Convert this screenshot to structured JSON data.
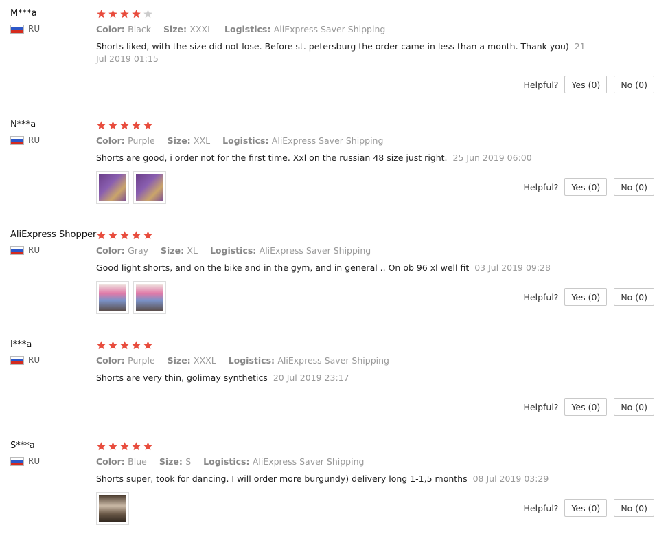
{
  "colors": {
    "star_on": "#e84c3d",
    "star_off": "#cccccc",
    "muted": "#999999"
  },
  "labels": {
    "color": "Color:",
    "size": "Size:",
    "logistics": "Logistics:",
    "helpful": "Helpful?"
  },
  "reviews": [
    {
      "user": "M***a",
      "country": "RU",
      "rating": 4,
      "color": "Black",
      "size": "XXXL",
      "logistics": "AliExpress Saver Shipping",
      "text": "Shorts liked, with the size did not lose. Before st. petersburg the order came in less than a month. Thank you)",
      "date": "21 Jul 2019 01:15",
      "photos": [],
      "yes": "Yes (0)",
      "no": "No (0)"
    },
    {
      "user": "N***a",
      "country": "RU",
      "rating": 5,
      "color": "Purple",
      "size": "XXL",
      "logistics": "AliExpress Saver Shipping",
      "text": "Shorts are good, i order not for the first time. Xxl on the russian 48 size just right.",
      "date": "25 Jun 2019 06:00",
      "photos": [
        "purple-shorts-photo",
        "purple-shorts-photo"
      ],
      "yes": "Yes (0)",
      "no": "No (0)"
    },
    {
      "user": "AliExpress Shopper",
      "country": "RU",
      "rating": 5,
      "color": "Gray",
      "size": "XL",
      "logistics": "AliExpress Saver Shipping",
      "text": "Good light shorts, and on the bike and in the gym, and in general .. On ob 96 xl well fit",
      "date": "03 Jul 2019 09:28",
      "photos": [
        "person-wearing-shorts-photo",
        "person-wearing-shorts-photo"
      ],
      "yes": "Yes (0)",
      "no": "No (0)"
    },
    {
      "user": "I***a",
      "country": "RU",
      "rating": 5,
      "color": "Purple",
      "size": "XXXL",
      "logistics": "AliExpress Saver Shipping",
      "text": "Shorts are very thin, golimay synthetics",
      "date": "20 Jul 2019 23:17",
      "photos": [],
      "yes": "Yes (0)",
      "no": "No (0)"
    },
    {
      "user": "S***a",
      "country": "RU",
      "rating": 5,
      "color": "Blue",
      "size": "S",
      "logistics": "AliExpress Saver Shipping",
      "text": "Shorts super, took for dancing. I will order more burgundy) delivery long 1-1,5 months",
      "date": "08 Jul 2019 03:29",
      "photos": [
        "person-in-room-photo"
      ],
      "yes": "Yes (0)",
      "no": "No (0)"
    }
  ]
}
